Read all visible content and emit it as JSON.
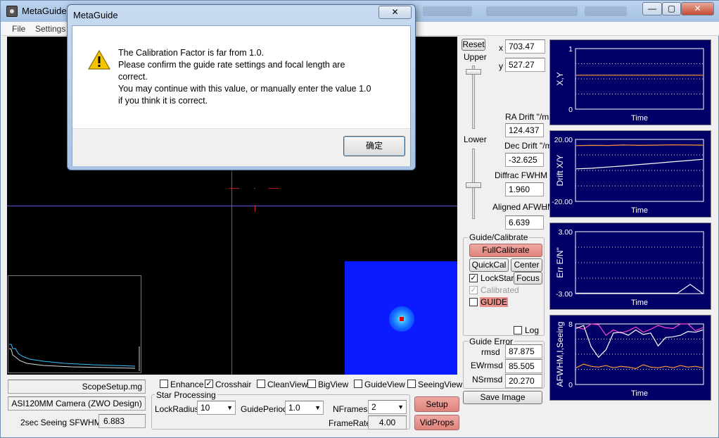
{
  "window": {
    "title": "MetaGuide",
    "btn_minimize": "—",
    "btn_maximize": "▢",
    "btn_close": "✕"
  },
  "menu": {
    "items": [
      "File",
      "Settings"
    ]
  },
  "dialog": {
    "title": "MetaGuide",
    "close": "✕",
    "lines": [
      "The Calibration Factor is far from 1.0.",
      "Please confirm the guide rate settings and focal length are",
      "correct.",
      "You may continue with this value, or manually enter the value 1.0",
      "if you think it is correct."
    ],
    "ok_label": "确定"
  },
  "controls": {
    "reset_label": "Reset",
    "upper_label": "Upper",
    "lower_label": "Lower",
    "x_label": "x",
    "x_value": "703.47",
    "y_label": "y",
    "y_value": "527.27",
    "ra_drift_label": "RA Drift \"/m",
    "ra_drift_value": "124.437",
    "dec_drift_label": "Dec Drift \"/m",
    "dec_drift_value": "-32.625",
    "diffrac_label": "Diffrac FWHM \"",
    "diffrac_value": "1.960",
    "aligned_label": "Aligned AFWHM",
    "aligned_quote": "\"",
    "aligned_value": "6.639"
  },
  "guide_calibrate": {
    "title": "Guide/Calibrate",
    "full_calibrate": "FullCalibrate",
    "quickcal": "QuickCal",
    "center": "Center",
    "lockstar": "LockStar",
    "focus": "Focus",
    "calibrated": "Calibrated",
    "guide": "GUIDE",
    "log": "Log"
  },
  "guide_error": {
    "title": "Guide Error",
    "rmsd_label": "rmsd",
    "rmsd_value": "87.875",
    "ewrmsd_label": "EWrmsd",
    "ewrmsd_value": "85.505",
    "nsrmsd_label": "NSrmsd",
    "nsrmsd_value": "20.270"
  },
  "save_image": "Save Image",
  "bottom": {
    "scope_setup": "ScopeSetup.mg",
    "camera": "ASI120MM Camera (ZWO Design)",
    "seeing_label": "2sec Seeing SFWHM\"",
    "seeing_value": "6.883",
    "options": {
      "enhance": "Enhance",
      "crosshair": "Crosshair",
      "cleanview": "CleanView",
      "bigview": "BigView",
      "guideview": "GuideView",
      "seeingview": "SeeingView"
    },
    "star_processing": "Star Processing",
    "lockradius_label": "LockRadius",
    "lockradius_value": "10",
    "guideperiod_label": "GuidePeriod",
    "guideperiod_value": "1.0",
    "nframes_label": "NFrames",
    "nframes_value": "2",
    "framerate_label": "FrameRate",
    "framerate_value": "4.00",
    "setup": "Setup",
    "vidprops": "VidProps"
  },
  "colors": {
    "plot_bg": "#000066",
    "accent_orange": "#ff9933",
    "red_button": "#e8918a"
  },
  "chart_data": [
    {
      "type": "line",
      "ylabel": "X,Y",
      "xlabel": "Time",
      "ylim": [
        0,
        1
      ],
      "yticks": [
        "1",
        "0"
      ],
      "series": [
        {
          "color": "#ff9933",
          "values": [
            0.56,
            0.56,
            0.56,
            0.56,
            0.56,
            0.56,
            0.56
          ]
        }
      ]
    },
    {
      "type": "line",
      "ylabel": "Drift X/Y",
      "xlabel": "Time",
      "ylim": [
        -20,
        20
      ],
      "yticks": [
        "20.00",
        "-20.00"
      ],
      "series": [
        {
          "color": "#ff9933",
          "values": [
            16,
            16.2,
            16.1,
            16.4,
            16.2,
            16.3,
            16.5,
            16.4,
            16.3
          ]
        },
        {
          "color": "#ffffff",
          "values": [
            1,
            1.4,
            2.2,
            2.9,
            3.8,
            4.6,
            5.5,
            6.3,
            7.2
          ]
        }
      ]
    },
    {
      "type": "line",
      "ylabel": "Err E/N\"",
      "xlabel": "Time",
      "ylim": [
        -3,
        3
      ],
      "yticks": [
        "3.00",
        "-3.00"
      ],
      "series": [
        {
          "color": "#ffffff",
          "values": [
            -2.95,
            -2.95,
            -2.95,
            -2.95,
            -2.95,
            -2.95,
            -2.95,
            -2.95,
            -2.95,
            -2.1,
            -3.0
          ]
        }
      ]
    },
    {
      "type": "line",
      "ylabel": "AFWHM,I,Seeing",
      "xlabel": "Time",
      "ylim": [
        0,
        8
      ],
      "yticks": [
        "8",
        "0"
      ],
      "series": [
        {
          "color": "#ff44cc",
          "values": [
            7.6,
            7.3,
            8,
            7.9,
            6.5,
            7.2,
            6.8,
            7.1,
            7.6,
            6.9,
            7.3,
            7.8,
            7.5,
            7.4,
            8,
            8,
            7.1,
            7.5
          ]
        },
        {
          "color": "#ffffff",
          "values": [
            7.4,
            7.8,
            5.0,
            3.6,
            4.6,
            6.8,
            6.9,
            6.5,
            7.2,
            6.6,
            6.8,
            5.1,
            6.2,
            6.3,
            6.5,
            7.0,
            6.9,
            7.2
          ]
        },
        {
          "color": "#ff9933",
          "values": [
            2.2,
            2.7,
            2.4,
            2.3,
            2.5,
            2.2,
            2.4,
            2.3,
            2.1,
            2.6,
            2.3,
            2.2,
            2.4,
            2.2,
            2.5,
            2.3,
            2.4,
            2.2
          ]
        }
      ]
    }
  ]
}
